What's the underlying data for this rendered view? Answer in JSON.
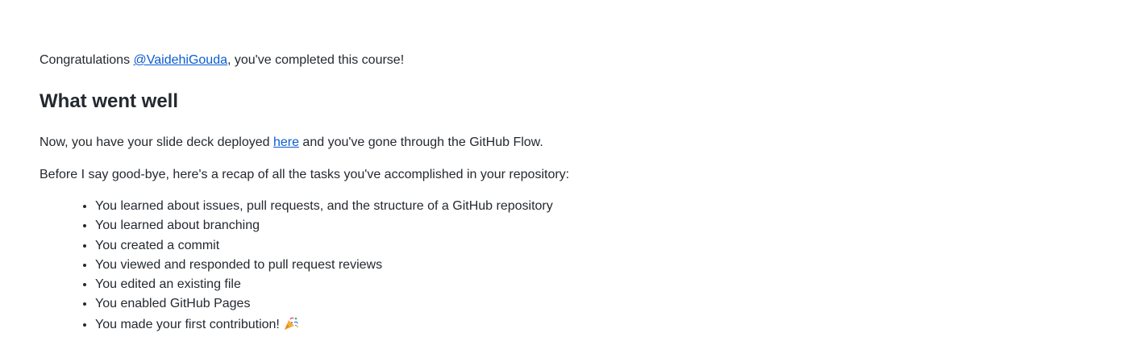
{
  "congrats": {
    "prefix": "Congratulations ",
    "username": "@VaidehiGouda",
    "suffix": ", you've completed this course!"
  },
  "section": {
    "title": "What went well"
  },
  "deploy": {
    "prefix": "Now, you have your slide deck deployed ",
    "link_text": "here",
    "suffix": " and you've gone through the GitHub Flow."
  },
  "recap_intro": "Before I say good-bye, here's a recap of all the tasks you've accomplished in your repository:",
  "tasks": [
    "You learned about issues, pull requests, and the structure of a GitHub repository",
    "You learned about branching",
    "You created a commit",
    "You viewed and responded to pull request reviews",
    "You edited an existing file",
    "You enabled GitHub Pages",
    "You made your first contribution!"
  ],
  "icons": {
    "last_task_icon": "party-popper-icon"
  },
  "colors": {
    "link": "#0b5bd3",
    "text": "#24292f"
  }
}
